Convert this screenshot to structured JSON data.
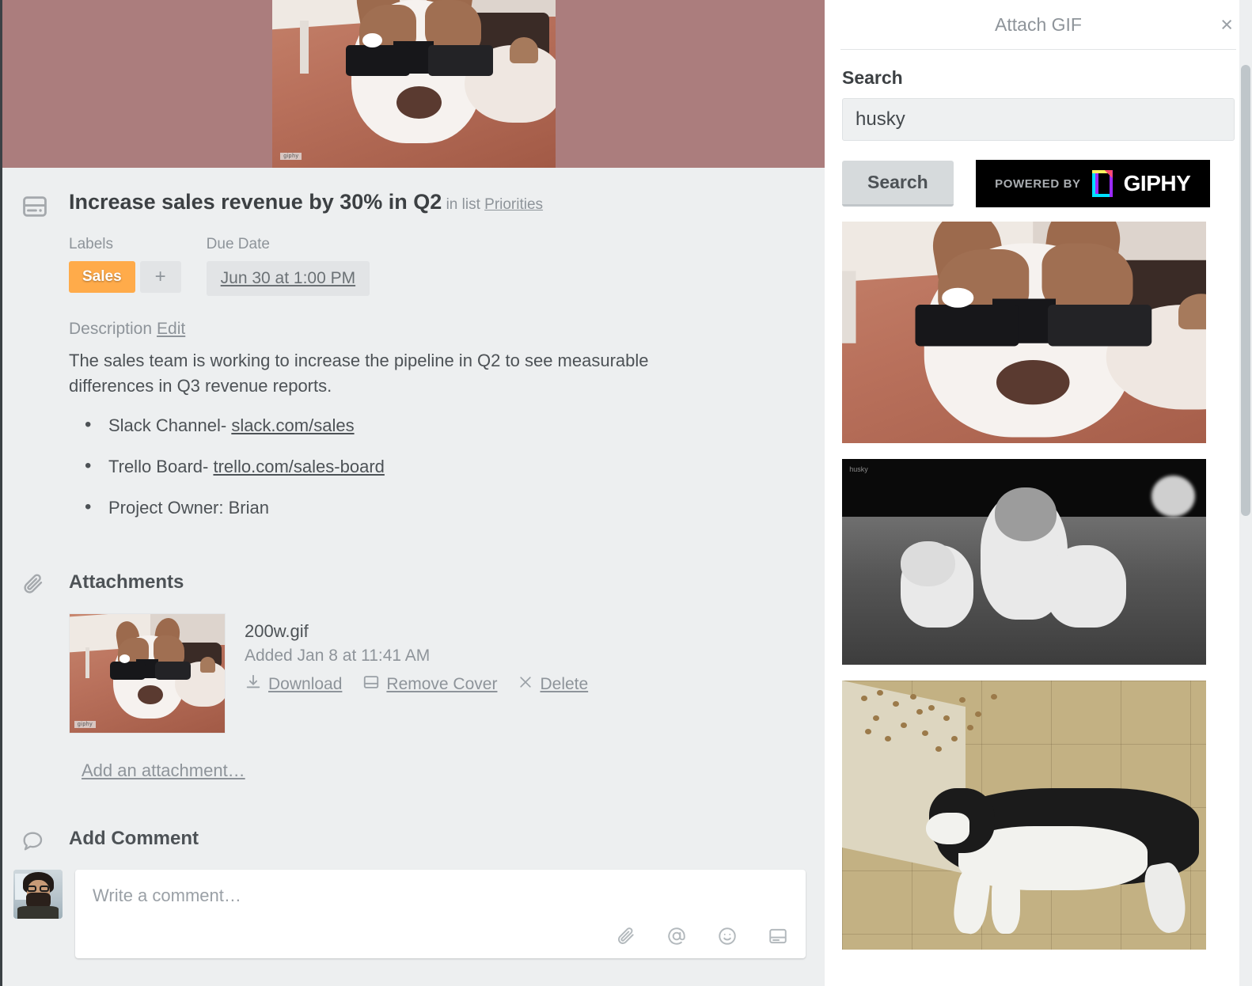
{
  "card": {
    "icon": "card-icon",
    "title": "Increase sales revenue by 30% in Q2",
    "in_list_prefix": "in list",
    "list_name": "Priorities",
    "labels_heading": "Labels",
    "label_chip": "Sales",
    "label_chip_color": "#ffab4a",
    "add_label": "+",
    "due_heading": "Due Date",
    "due_value": "Jun 30 at 1:00 PM",
    "description_heading": "Description",
    "description_edit": "Edit",
    "description_text": "The sales team is working to increase the pipeline in Q2 to see measurable differences in Q3 revenue reports.",
    "description_items": [
      {
        "text": "Slack Channel- ",
        "link": "slack.com/sales"
      },
      {
        "text": "Trello Board- ",
        "link": "trello.com/sales-board"
      },
      {
        "text": "Project Owner: Brian",
        "link": ""
      }
    ],
    "attachments_heading": "Attachments",
    "attachment": {
      "name": "200w.gif",
      "added": "Added Jan 8 at 11:41 AM",
      "download": "Download",
      "remove_cover": "Remove Cover",
      "delete": "Delete"
    },
    "add_attachment": "Add an attachment…",
    "comment_heading": "Add Comment",
    "comment_placeholder": "Write a comment…",
    "comment_tools": [
      "paperclip-icon",
      "mention-icon",
      "emoji-icon",
      "card-icon"
    ]
  },
  "gif_panel": {
    "title": "Attach GIF",
    "close": "×",
    "search_label": "Search",
    "search_value": "husky",
    "search_placeholder": "Search",
    "search_button": "Search",
    "giphy_powered_by": "POWERED BY",
    "giphy_word": "GIPHY",
    "results": [
      {
        "alt": "husky wearing sunglasses"
      },
      {
        "alt": "black and white husky puppies on grass"
      },
      {
        "alt": "husky lying on tile floor near spilled kibble"
      }
    ]
  }
}
